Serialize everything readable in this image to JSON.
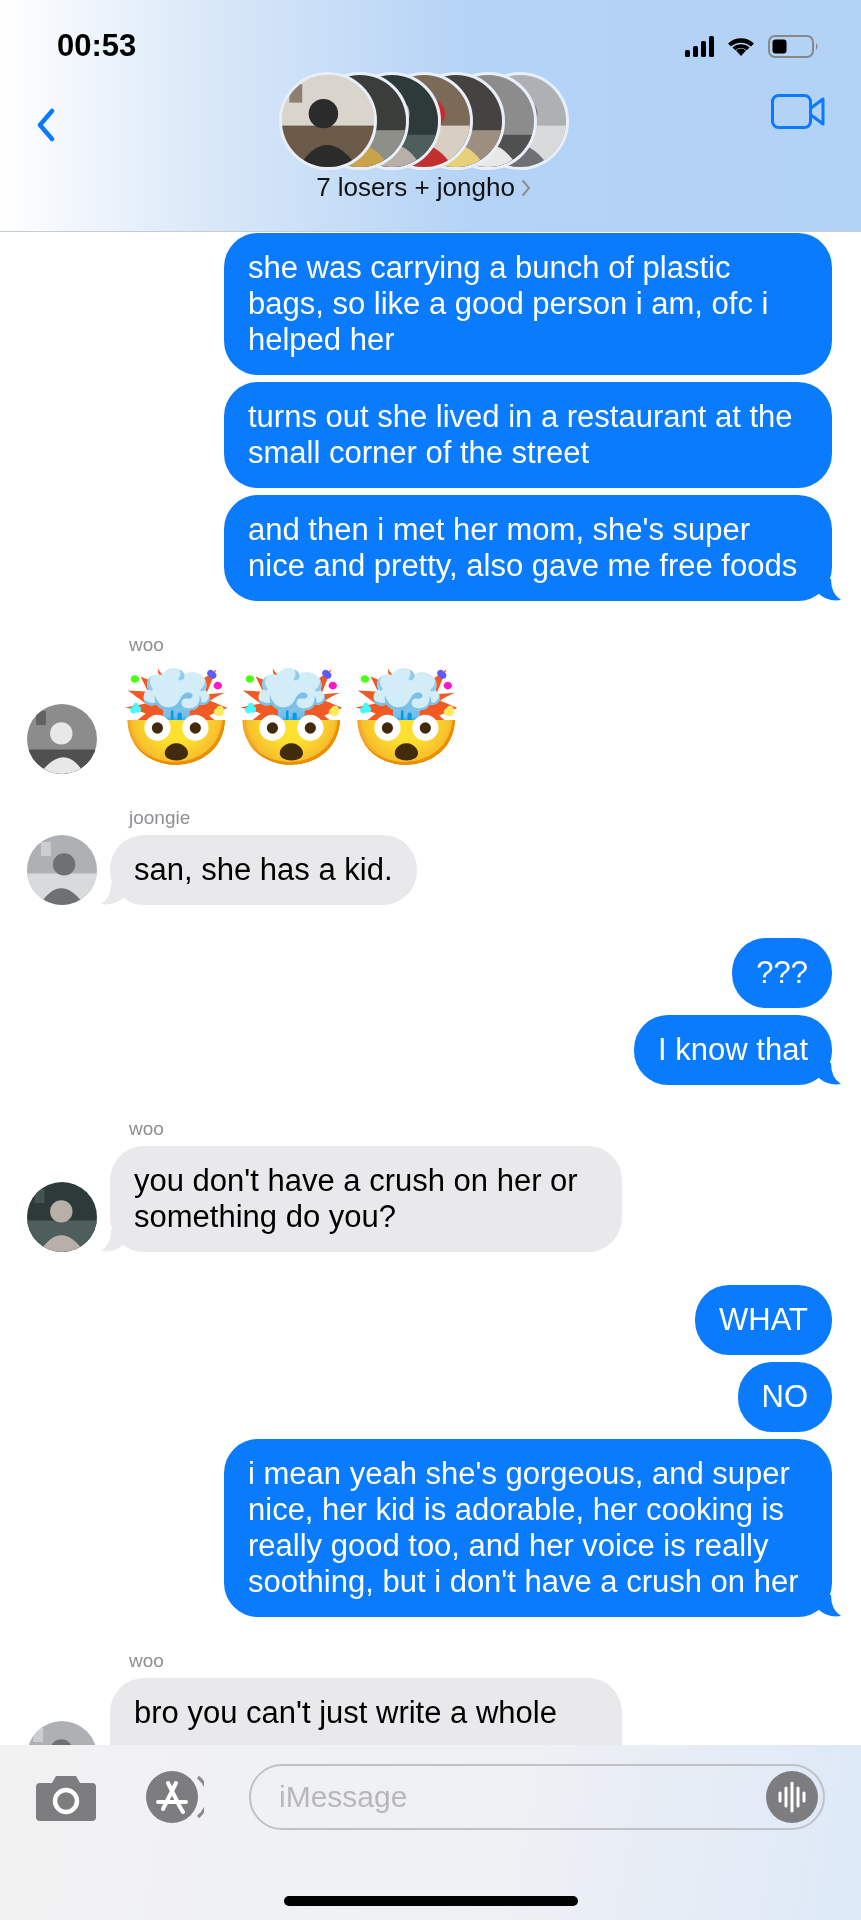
{
  "status_bar": {
    "time": "00:53"
  },
  "header": {
    "title": "7 losers + jongho"
  },
  "messages": [
    {
      "kind": "sent",
      "text": "she was carrying a bunch of plastic bags, so like a good person i am, ofc i helped her",
      "tail": false
    },
    {
      "kind": "sent",
      "text": "turns out she lived in a restaurant at the small corner of the street",
      "tail": false
    },
    {
      "kind": "sent",
      "text": "and then i met her mom, she's super nice and pretty, also gave me free foods",
      "tail": true
    },
    {
      "kind": "received_emoji",
      "sender": "woo",
      "text": "🤯🤯🤯",
      "avatar": true
    },
    {
      "kind": "received",
      "sender": "joongie",
      "text": "san, she has a kid.",
      "tail": true,
      "avatar": true
    },
    {
      "kind": "sent",
      "text": "???",
      "tail": false
    },
    {
      "kind": "sent",
      "text": "I know that",
      "tail": true
    },
    {
      "kind": "received",
      "sender": "woo",
      "text": "you don't have a crush on her or something do you?",
      "tail": true,
      "avatar": true
    },
    {
      "kind": "sent",
      "text": "WHAT",
      "tail": false
    },
    {
      "kind": "sent",
      "text": "NO",
      "tail": false
    },
    {
      "kind": "sent",
      "text": "i mean yeah she's gorgeous, and super nice, her kid is adorable, her cooking is really good too, and her voice is really soothing, but i don't have a crush on her",
      "tail": true
    },
    {
      "kind": "received",
      "sender": "woo",
      "text": "bro you can't just write a whole",
      "avatar": true
    }
  ],
  "composer": {
    "placeholder": "iMessage"
  }
}
